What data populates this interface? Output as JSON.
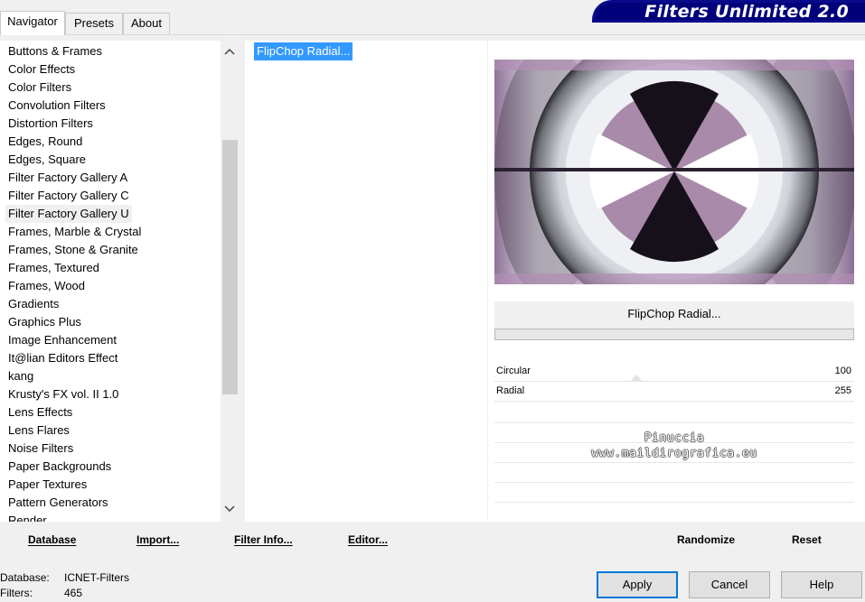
{
  "tabs": [
    {
      "label": "Navigator",
      "active": true
    },
    {
      "label": "Presets",
      "active": false
    },
    {
      "label": "About",
      "active": false
    }
  ],
  "title": "Filters Unlimited 2.0",
  "categories": [
    "Buttons & Frames",
    "Color Effects",
    "Color Filters",
    "Convolution Filters",
    "Distortion Filters",
    "Edges, Round",
    "Edges, Square",
    "Filter Factory Gallery A",
    "Filter Factory Gallery C",
    "Filter Factory Gallery U",
    "Frames, Marble & Crystal",
    "Frames, Stone & Granite",
    "Frames, Textured",
    "Frames, Wood",
    "Gradients",
    "Graphics Plus",
    "Image Enhancement",
    "It@lian Editors Effect",
    "kang",
    "Krusty's FX vol. II 1.0",
    "Lens Effects",
    "Lens Flares",
    "Noise Filters",
    "Paper Backgrounds",
    "Paper Textures",
    "Pattern Generators",
    "Render"
  ],
  "selected_category": "Filter Factory Gallery U",
  "filters": [
    "FlipChop Radial..."
  ],
  "selected_filter_name": "FlipChop Radial...",
  "params": [
    {
      "label": "Circular",
      "value": "100"
    },
    {
      "label": "Radial",
      "value": "255"
    }
  ],
  "watermark": {
    "line1": "Pinuccia",
    "line2": "www.maildirografica.eu"
  },
  "bottom_left_buttons": {
    "database": "Database",
    "import": "Import...",
    "filter_info": "Filter Info...",
    "editor": "Editor..."
  },
  "bottom_right_buttons": {
    "randomize": "Randomize",
    "reset": "Reset"
  },
  "status": {
    "database_label": "Database:",
    "database_value": "ICNET-Filters",
    "filters_label": "Filters:",
    "filters_value": "465"
  },
  "dialog_buttons": {
    "apply": "Apply",
    "cancel": "Cancel",
    "help": "Help"
  },
  "colors": {
    "accent": "#3399ff",
    "banner": "#00007a",
    "default_border": "#0078d7"
  },
  "icons": {
    "scroll_up": "chevron-up-icon",
    "scroll_down": "chevron-down-icon"
  }
}
